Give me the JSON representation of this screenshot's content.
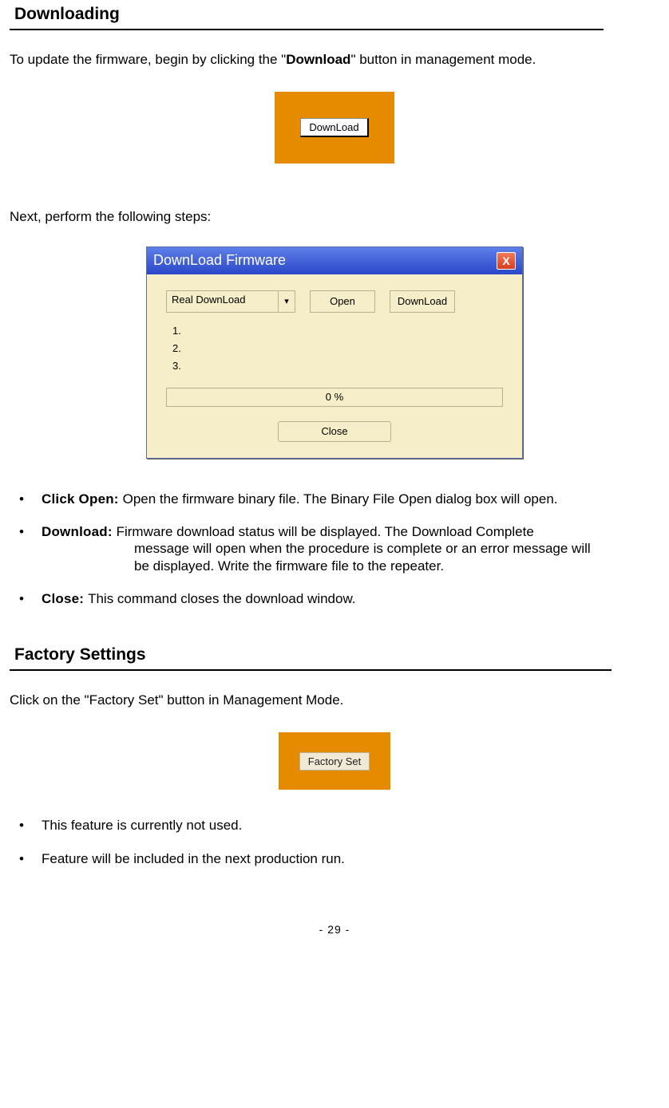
{
  "section1": {
    "title": "Downloading",
    "intro_pre": "To update the firmware, begin by clicking the \"",
    "intro_bold": "Download",
    "intro_post": "\" button in management mode.",
    "btn_download_label": "DownLoad",
    "next_steps": "Next, perform the following steps:"
  },
  "dialog": {
    "title": "DownLoad Firmware",
    "close_x": "X",
    "combo_value": "Real DownLoad",
    "combo_arrow": "▾",
    "btn_open": "Open",
    "btn_download": "DownLoad",
    "list1": "1.",
    "list2": "2.",
    "list3": "3.",
    "progress": "0 %",
    "btn_close": "Close"
  },
  "bullets1": {
    "b1_term": "Click Open: ",
    "b1_lead": "Open the ",
    "b1_rest": "firmware binary file. The Binary File Open dialog box will open.",
    "b2_term": "Download: ",
    "b2_line1": "Firmware download status will be displayed. The Download Complete",
    "b2_line2": "message will open when the procedure is complete or an error message will",
    "b2_line3": "be displayed. Write the firmware file to the repeater.",
    "b3_term": "Close: ",
    "b3_rest": "This command closes the download window."
  },
  "section2": {
    "title": "Factory Settings",
    "intro": "Click on the \"Factory Set\" button in Management Mode.",
    "btn_label": "Factory Set"
  },
  "bullets2": {
    "b1": "This feature is currently not used.",
    "b2": "Feature will be included in the next production run."
  },
  "footer": {
    "page": "-  29  -"
  }
}
